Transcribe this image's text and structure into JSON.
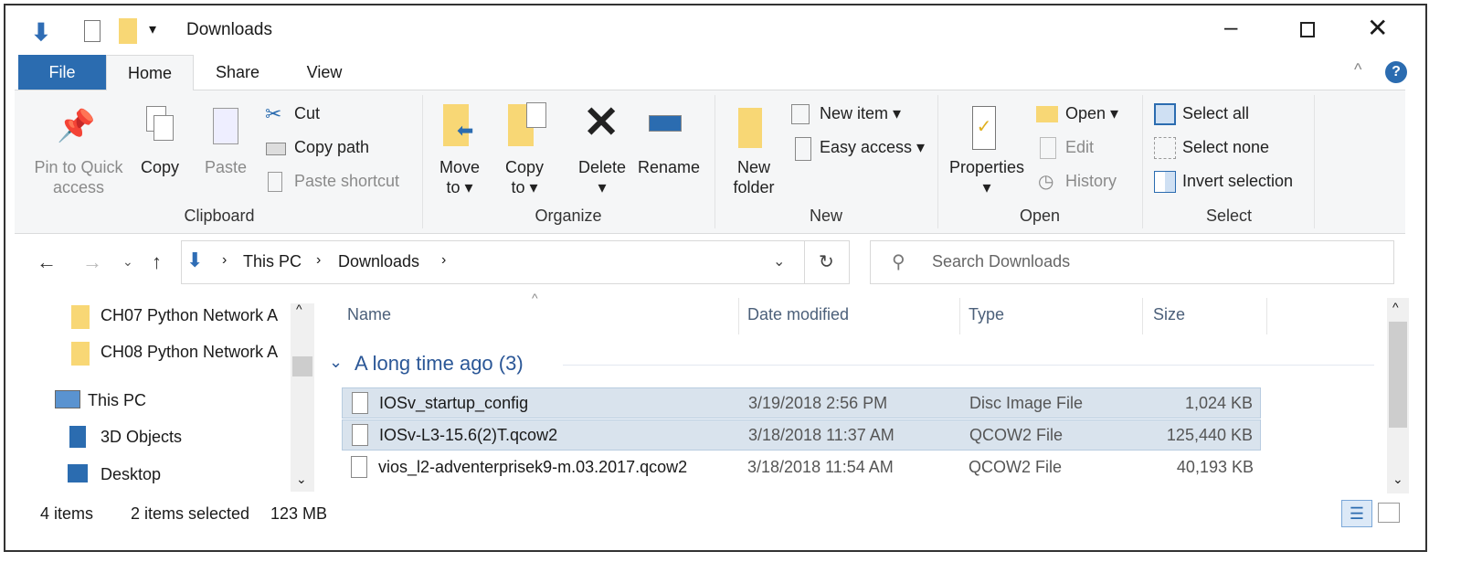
{
  "window": {
    "title": "Downloads",
    "controls": [
      "minimize",
      "maximize",
      "close"
    ]
  },
  "ribbon_tabs": {
    "file": "File",
    "home": "Home",
    "share": "Share",
    "view": "View"
  },
  "clipboard": {
    "pin": "Pin to Quick",
    "pin2": "access",
    "copy": "Copy",
    "paste": "Paste",
    "cut": "Cut",
    "copy_path": "Copy path",
    "paste_shortcut": "Paste shortcut",
    "group": "Clipboard"
  },
  "organize": {
    "move": "Move",
    "move2": "to ▾",
    "copy": "Copy",
    "copy2": "to ▾",
    "delete": "Delete",
    "delete2": "▾",
    "rename": "Rename",
    "group": "Organize"
  },
  "new": {
    "new_folder": "New",
    "new_folder2": "folder",
    "new_item": "New item ▾",
    "easy_access": "Easy access ▾",
    "group": "New"
  },
  "open": {
    "properties": "Properties",
    "properties2": "▾",
    "open": "Open ▾",
    "edit": "Edit",
    "history": "History",
    "group": "Open"
  },
  "select": {
    "select_all": "Select all",
    "select_none": "Select none",
    "invert": "Invert selection",
    "group": "Select"
  },
  "address": {
    "crumbs": [
      "This PC",
      "Downloads"
    ],
    "search_placeholder": "Search Downloads"
  },
  "nav_pane": {
    "items": [
      "CH07 Python Network A",
      "CH08 Python Network A",
      "This PC",
      "3D Objects",
      "Desktop"
    ]
  },
  "columns": {
    "name": "Name",
    "date": "Date modified",
    "type": "Type",
    "size": "Size"
  },
  "group_header": "A long time ago (3)",
  "files": [
    {
      "name": "IOSv_startup_config",
      "date": "3/19/2018 2:56 PM",
      "type": "Disc Image File",
      "size": "1,024 KB",
      "selected": true
    },
    {
      "name": "IOSv-L3-15.6(2)T.qcow2",
      "date": "3/18/2018 11:37 AM",
      "type": "QCOW2 File",
      "size": "125,440 KB",
      "selected": true
    },
    {
      "name": "vios_l2-adventerprisek9-m.03.2017.qcow2",
      "date": "3/18/2018 11:54 AM",
      "type": "QCOW2 File",
      "size": "40,193 KB",
      "selected": false
    }
  ],
  "status": {
    "count": "4 items",
    "selected": "2 items selected",
    "size": "123 MB"
  },
  "colors": {
    "accent": "#2b6cb0",
    "selection": "#d9e3ed",
    "folder": "#f8d775"
  }
}
